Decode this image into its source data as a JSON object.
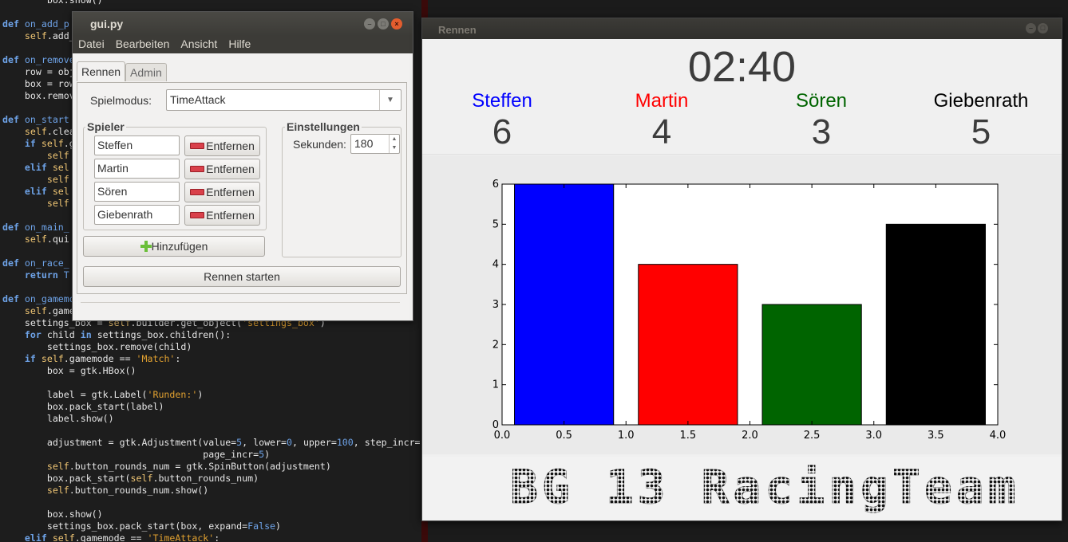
{
  "editor": {
    "lines": [
      [
        {
          "t": "        box.show()"
        }
      ],
      [
        {
          "t": ""
        }
      ],
      [
        {
          "t": "def ",
          "c": "kw"
        },
        {
          "t": "on_add_p",
          "c": "fn"
        }
      ],
      [
        {
          "t": "    "
        },
        {
          "t": "self",
          "c": "sf"
        },
        {
          "t": ".add_"
        }
      ],
      [
        {
          "t": ""
        }
      ],
      [
        {
          "t": "def ",
          "c": "kw"
        },
        {
          "t": "on_remove",
          "c": "fn"
        }
      ],
      [
        {
          "t": "    row = obj"
        }
      ],
      [
        {
          "t": "    box = row"
        }
      ],
      [
        {
          "t": "    box.remov"
        }
      ],
      [
        {
          "t": ""
        }
      ],
      [
        {
          "t": "def ",
          "c": "kw"
        },
        {
          "t": "on_start",
          "c": "fn"
        }
      ],
      [
        {
          "t": "    "
        },
        {
          "t": "self",
          "c": "sf"
        },
        {
          "t": ".clea"
        }
      ],
      [
        {
          "t": "    "
        },
        {
          "t": "if ",
          "c": "kw"
        },
        {
          "t": "self",
          "c": "sf"
        },
        {
          "t": ".g"
        }
      ],
      [
        {
          "t": "        "
        },
        {
          "t": "self",
          "c": "sf"
        }
      ],
      [
        {
          "t": "    "
        },
        {
          "t": "elif ",
          "c": "kw"
        },
        {
          "t": "sel",
          "c": "sf"
        }
      ],
      [
        {
          "t": "        "
        },
        {
          "t": "self",
          "c": "sf"
        }
      ],
      [
        {
          "t": "    "
        },
        {
          "t": "elif ",
          "c": "kw"
        },
        {
          "t": "sel",
          "c": "sf"
        }
      ],
      [
        {
          "t": "        "
        },
        {
          "t": "self",
          "c": "sf"
        }
      ],
      [
        {
          "t": ""
        }
      ],
      [
        {
          "t": "def ",
          "c": "kw"
        },
        {
          "t": "on_main_",
          "c": "fn"
        }
      ],
      [
        {
          "t": "    "
        },
        {
          "t": "self",
          "c": "sf"
        },
        {
          "t": ".qui"
        }
      ],
      [
        {
          "t": ""
        }
      ],
      [
        {
          "t": "def ",
          "c": "kw"
        },
        {
          "t": "on_race_",
          "c": "fn"
        }
      ],
      [
        {
          "t": "    "
        },
        {
          "t": "return ",
          "c": "kw"
        },
        {
          "t": "T",
          "c": "nm"
        }
      ],
      [
        {
          "t": ""
        }
      ],
      [
        {
          "t": "def ",
          "c": "kw"
        },
        {
          "t": "on_gamemo",
          "c": "fn"
        }
      ],
      [
        {
          "t": "    "
        },
        {
          "t": "self",
          "c": "sf"
        },
        {
          "t": ".game"
        }
      ],
      [
        {
          "t": "    settings_box = "
        },
        {
          "t": "self",
          "c": "sf"
        },
        {
          "t": ".builder.get_object("
        },
        {
          "t": "'settings_box'",
          "c": "st"
        },
        {
          "t": ")"
        }
      ],
      [
        {
          "t": "    "
        },
        {
          "t": "for ",
          "c": "kw"
        },
        {
          "t": "child "
        },
        {
          "t": "in ",
          "c": "kw"
        },
        {
          "t": "settings_box.children():"
        }
      ],
      [
        {
          "t": "        settings_box.remove(child)"
        }
      ],
      [
        {
          "t": "    "
        },
        {
          "t": "if ",
          "c": "kw"
        },
        {
          "t": "self",
          "c": "sf"
        },
        {
          "t": ".gamemode == "
        },
        {
          "t": "'Match'",
          "c": "st"
        },
        {
          "t": ":"
        }
      ],
      [
        {
          "t": "        box = gtk.HBox()"
        }
      ],
      [
        {
          "t": ""
        }
      ],
      [
        {
          "t": "        label = gtk.Label("
        },
        {
          "t": "'Runden:'",
          "c": "st"
        },
        {
          "t": ")"
        }
      ],
      [
        {
          "t": "        box.pack_start(label)"
        }
      ],
      [
        {
          "t": "        label.show()"
        }
      ],
      [
        {
          "t": ""
        }
      ],
      [
        {
          "t": "        adjustment = gtk.Adjustment(value="
        },
        {
          "t": "5",
          "c": "nm"
        },
        {
          "t": ", lower="
        },
        {
          "t": "0",
          "c": "nm"
        },
        {
          "t": ", upper="
        },
        {
          "t": "100",
          "c": "nm"
        },
        {
          "t": ", step_incr="
        }
      ],
      [
        {
          "t": "                                    page_incr="
        },
        {
          "t": "5",
          "c": "nm"
        },
        {
          "t": ")"
        }
      ],
      [
        {
          "t": "        "
        },
        {
          "t": "self",
          "c": "sf"
        },
        {
          "t": ".button_rounds_num = gtk.SpinButton(adjustment)"
        }
      ],
      [
        {
          "t": "        box.pack_start("
        },
        {
          "t": "self",
          "c": "sf"
        },
        {
          "t": ".button_rounds_num)"
        }
      ],
      [
        {
          "t": "        "
        },
        {
          "t": "self",
          "c": "sf"
        },
        {
          "t": ".button_rounds_num.show()"
        }
      ],
      [
        {
          "t": ""
        }
      ],
      [
        {
          "t": "        box.show()"
        }
      ],
      [
        {
          "t": "        settings_box.pack_start(box, expand="
        },
        {
          "t": "False",
          "c": "nm"
        },
        {
          "t": ")"
        }
      ],
      [
        {
          "t": "    "
        },
        {
          "t": "elif ",
          "c": "kw"
        },
        {
          "t": "self",
          "c": "sf"
        },
        {
          "t": ".gamemode == "
        },
        {
          "t": "'TimeAttack'",
          "c": "st"
        },
        {
          "t": ":"
        }
      ]
    ]
  },
  "gui_window": {
    "title": "gui.py",
    "menu": [
      "Datei",
      "Bearbeiten",
      "Ansicht",
      "Hilfe"
    ],
    "tabs": [
      "Rennen",
      "Admin"
    ],
    "mode_label": "Spielmodus:",
    "mode_value": "TimeAttack",
    "players_title": "Spieler",
    "players": [
      "Steffen",
      "Martin",
      "Sören",
      "Giebenrath"
    ],
    "remove_label": "Entfernen",
    "add_label": "Hinzufügen",
    "settings_title": "Einstellungen",
    "seconds_label": "Sekunden:",
    "seconds_value": "180",
    "start_label": "Rennen starten"
  },
  "race_window": {
    "title": "Rennen",
    "timer": "02:40",
    "players": [
      {
        "name": "Steffen",
        "score": "6",
        "color": "#0000ff"
      },
      {
        "name": "Martin",
        "score": "4",
        "color": "#ff0000"
      },
      {
        "name": "Sören",
        "score": "3",
        "color": "#006400"
      },
      {
        "name": "Giebenrath",
        "score": "5",
        "color": "#000000"
      }
    ],
    "logo": "BG 13 RacingTeam"
  },
  "chart_data": {
    "type": "bar",
    "x": [
      0.1,
      1.1,
      2.1,
      3.1
    ],
    "width": 0.8,
    "values": [
      6,
      4,
      3,
      5
    ],
    "colors": [
      "#0000ff",
      "#ff0000",
      "#006400",
      "#000000"
    ],
    "xlim": [
      0.0,
      4.0
    ],
    "ylim": [
      0,
      6
    ],
    "xticks": [
      "0.0",
      "0.5",
      "1.0",
      "1.5",
      "2.0",
      "2.5",
      "3.0",
      "3.5",
      "4.0"
    ],
    "yticks": [
      "0",
      "1",
      "2",
      "3",
      "4",
      "5",
      "6"
    ],
    "grid": false
  }
}
